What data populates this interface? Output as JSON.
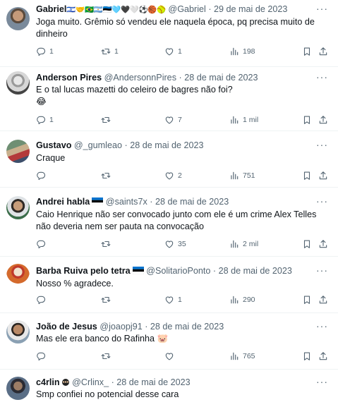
{
  "replies": [
    {
      "name": "Gabriel",
      "name_suffix": "🇮🇱🤝🇧🇷🇦🇷🇪🇪🩵🖤🤍⚽🏀🥎",
      "handle": "@Gabriel",
      "date": "29 de mai de 2023",
      "text": "Joga muito. Grêmio só vendeu ele naquela época, pq precisa muito de dinheiro",
      "replies": "1",
      "retweets": "1",
      "likes": "1",
      "views": "198"
    },
    {
      "name": "Anderson Pires",
      "handle": "@AndersonnPires",
      "date": "28 de mai de 2023",
      "text": "E o tal lucas mazetti do celeiro de bagres não foi?\n😂",
      "replies": "1",
      "retweets": "",
      "likes": "7",
      "views": "1 mil"
    },
    {
      "name": "Gustavo",
      "handle": "@_gumleao",
      "date": "28 de mai de 2023",
      "text": "Craque",
      "replies": "",
      "retweets": "",
      "likes": "2",
      "views": "751"
    },
    {
      "name": "Andrei habla",
      "handle": "@saints7x",
      "date": "28 de mai de 2023",
      "text": "Caio Henrique não ser convocado junto com ele é um crime Alex Telles não deveria nem ser pauta na convocação",
      "replies": "",
      "retweets": "",
      "likes": "35",
      "views": "2 mil"
    },
    {
      "name": "Barba Ruiva pelo tetra",
      "handle": "@SolitarioPonto",
      "date": "28 de mai de 2023",
      "text": "Nosso % agradece.",
      "replies": "",
      "retweets": "",
      "likes": "1",
      "views": "290"
    },
    {
      "name": "João de Jesus",
      "handle": "@joaopj91",
      "date": "28 de mai de 2023",
      "text": "Mas ele era banco do Rafinha 🐷",
      "replies": "",
      "retweets": "",
      "likes": "",
      "views": "765"
    },
    {
      "name": "c4rlin",
      "handle": "@Crlinx_",
      "date": "28 de mai de 2023",
      "text": "Smp confiei no potencial desse cara"
    }
  ],
  "dot": "·",
  "more": "···",
  "icons": {
    "reply": "reply-icon",
    "retweet": "retweet-icon",
    "like": "heart-icon",
    "views": "views-icon",
    "bookmark": "bookmark-icon",
    "share": "share-icon"
  },
  "colors": {
    "icon": "#536471",
    "text": "#0f1419",
    "divider": "#eff3f4",
    "estonia_blue": "#0072ce"
  }
}
